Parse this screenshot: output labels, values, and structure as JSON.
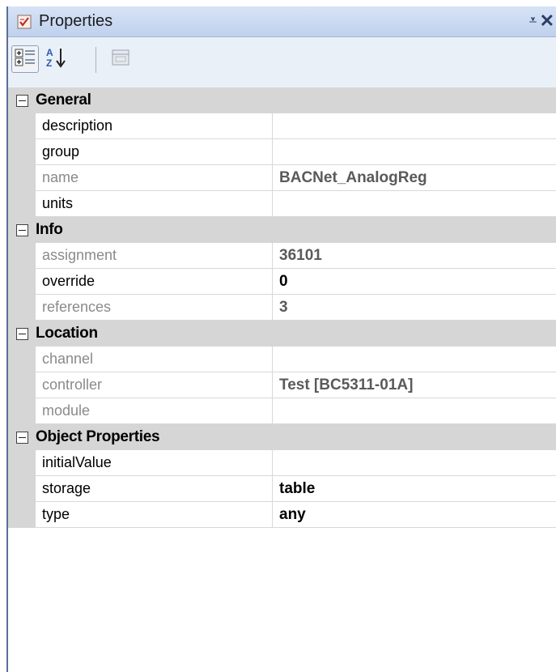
{
  "window": {
    "title": "Properties",
    "pin_glyph": "⩡",
    "close_glyph": "✕",
    "title_icon": "properties-check-icon"
  },
  "toolbar": {
    "buttons": [
      {
        "icon": "categorized-icon",
        "active": true
      },
      {
        "icon": "alphabetical-sort-icon",
        "active": false
      },
      {
        "icon": "property-pages-icon",
        "active": false,
        "disabled": true
      }
    ]
  },
  "categories": [
    {
      "label": "General",
      "properties": [
        {
          "name": "description",
          "value": "",
          "readonly": false,
          "bold": false
        },
        {
          "name": "group",
          "value": "",
          "readonly": false,
          "bold": false
        },
        {
          "name": "name",
          "value": "BACNet_AnalogReg",
          "readonly": true,
          "bold": false
        },
        {
          "name": "units",
          "value": "",
          "readonly": false,
          "bold": false
        }
      ]
    },
    {
      "label": "Info",
      "properties": [
        {
          "name": "assignment",
          "value": "36101",
          "readonly": true,
          "bold": false
        },
        {
          "name": "override",
          "value": "0",
          "readonly": false,
          "bold": true
        },
        {
          "name": "references",
          "value": "3",
          "readonly": true,
          "bold": false
        }
      ]
    },
    {
      "label": "Location",
      "properties": [
        {
          "name": "channel",
          "value": "",
          "readonly": true,
          "bold": false
        },
        {
          "name": "controller",
          "value": "Test [BC5311-01A]",
          "readonly": true,
          "bold": false
        },
        {
          "name": "module",
          "value": "",
          "readonly": true,
          "bold": false
        }
      ]
    },
    {
      "label": "Object Properties",
      "properties": [
        {
          "name": "initialValue",
          "value": "",
          "readonly": false,
          "bold": false
        },
        {
          "name": "storage",
          "value": "table",
          "readonly": false,
          "bold": true
        },
        {
          "name": "type",
          "value": "any",
          "readonly": false,
          "bold": true
        }
      ]
    }
  ],
  "colors": {
    "titlebar": "#c9d8f0",
    "category_bg": "#d6d6d6",
    "readonly_text": "#8a8a8a",
    "border": "#5b6f95"
  }
}
